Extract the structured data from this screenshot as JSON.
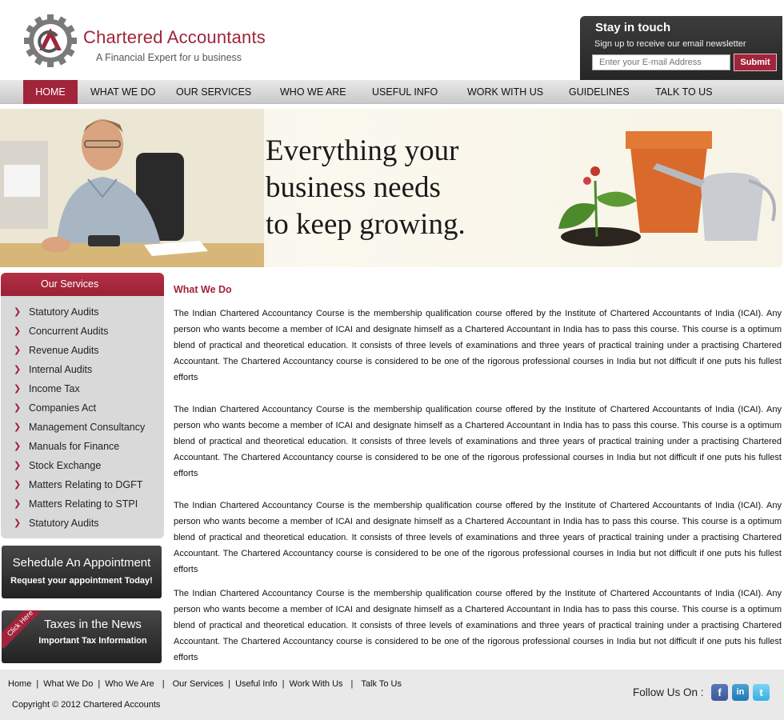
{
  "brand": {
    "title": "Chartered Accountants",
    "tagline": "A Financial Expert for u business"
  },
  "newsletter": {
    "title": "Stay in touch",
    "subtitle": "Sign up to receive our email newsletter",
    "email_placeholder": "Enter your E-mail Address",
    "submit_label": "Submit"
  },
  "nav": {
    "items": [
      {
        "label": "HOME",
        "active": true
      },
      {
        "label": "WHAT WE DO"
      },
      {
        "label": "OUR SERVICES"
      },
      {
        "label": "WHO WE ARE"
      },
      {
        "label": "USEFUL INFO"
      },
      {
        "label": "WORK WITH US"
      },
      {
        "label": "GUIDELINES"
      },
      {
        "label": "TALK TO US"
      }
    ]
  },
  "banner": {
    "line1": "Everything your",
    "line2": "business needs",
    "line3": "to keep growing."
  },
  "services": {
    "heading": "Our Services",
    "items": [
      "Statutory Audits",
      "Concurrent Audits",
      "Revenue Audits",
      "Internal Audits",
      "Income Tax",
      "Companies Act",
      "Management Consultancy",
      "Manuals for Finance",
      "Stock Exchange",
      "Matters Relating to DGFT",
      "Matters Relating to STPI",
      "Statutory Audits"
    ]
  },
  "appointment": {
    "title": "Sehedule An Appointment",
    "subtitle": "Request your appointment Today!"
  },
  "news": {
    "ribbon": "Click Here",
    "title": "Taxes in the News",
    "subtitle": "Important Tax Information"
  },
  "main": {
    "title": "What We Do",
    "paragraphs": [
      "The Indian Chartered Accountancy Course is the membership qualification course offered by the Institute of Chartered Accountants of India (ICAI). Any person who wants become a member of ICAI and designate himself as a Chartered Accountant in India has to pass this course. This course is a optimum blend of practical and theoretical education. It consists of three levels of examinations and three years of practical training under a practising Chartered Accountant. The Chartered Accountancy course is considered to be one of the rigorous professional courses in India but not difficult if one puts his fullest efforts",
      "The Indian Chartered Accountancy Course is the membership qualification course offered by the Institute of Chartered Accountants of India (ICAI). Any person who wants become a member of ICAI and designate himself as a Chartered Accountant in India has to pass this course. This course is a optimum blend of practical and theoretical education. It consists of three levels of examinations and three years of practical training under a practising Chartered Accountant. The Chartered Accountancy course is considered to be one of the rigorous professional courses in India but not difficult if one puts his fullest efforts",
      "The Indian Chartered Accountancy Course is the membership qualification course offered by the Institute of Chartered Accountants of India (ICAI). Any person who wants become a member of ICAI and designate himself as a Chartered Accountant in India has to pass this course. This course is a optimum blend of practical and theoretical education. It consists of three levels of examinations and three years of practical training under a practising Chartered Accountant. The Chartered Accountancy course is considered to be one of the rigorous professional courses in India but not difficult if one puts his fullest efforts",
      "The Indian Chartered Accountancy Course is the membership qualification course offered by the Institute of Chartered Accountants of India (ICAI). Any person who wants become a member of ICAI and designate himself as a Chartered Accountant in India has to pass this course. This course is a optimum blend of practical and theoretical education. It consists of three levels of examinations and three years of practical training under a practising Chartered Accountant. The Chartered Accountancy course is considered to be one of the rigorous professional courses in India but not difficult if one puts his fullest efforts"
    ]
  },
  "footer": {
    "links": [
      "Home",
      "What We Do",
      "Who We Are",
      "Our Services",
      "Useful Info",
      "Work With Us",
      "Talk To Us"
    ],
    "copyright": "Copyright © 2012 Chartered Accounts",
    "follow_label": "Follow Us On :",
    "social": [
      {
        "name": "facebook",
        "glyph": "f"
      },
      {
        "name": "linkedin",
        "glyph": "in"
      },
      {
        "name": "twitter",
        "glyph": "t"
      }
    ]
  },
  "colors": {
    "brand_red": "#a0243a",
    "dark_panel": "#2e2e2e",
    "nav_gray": "#d4d4d4"
  }
}
